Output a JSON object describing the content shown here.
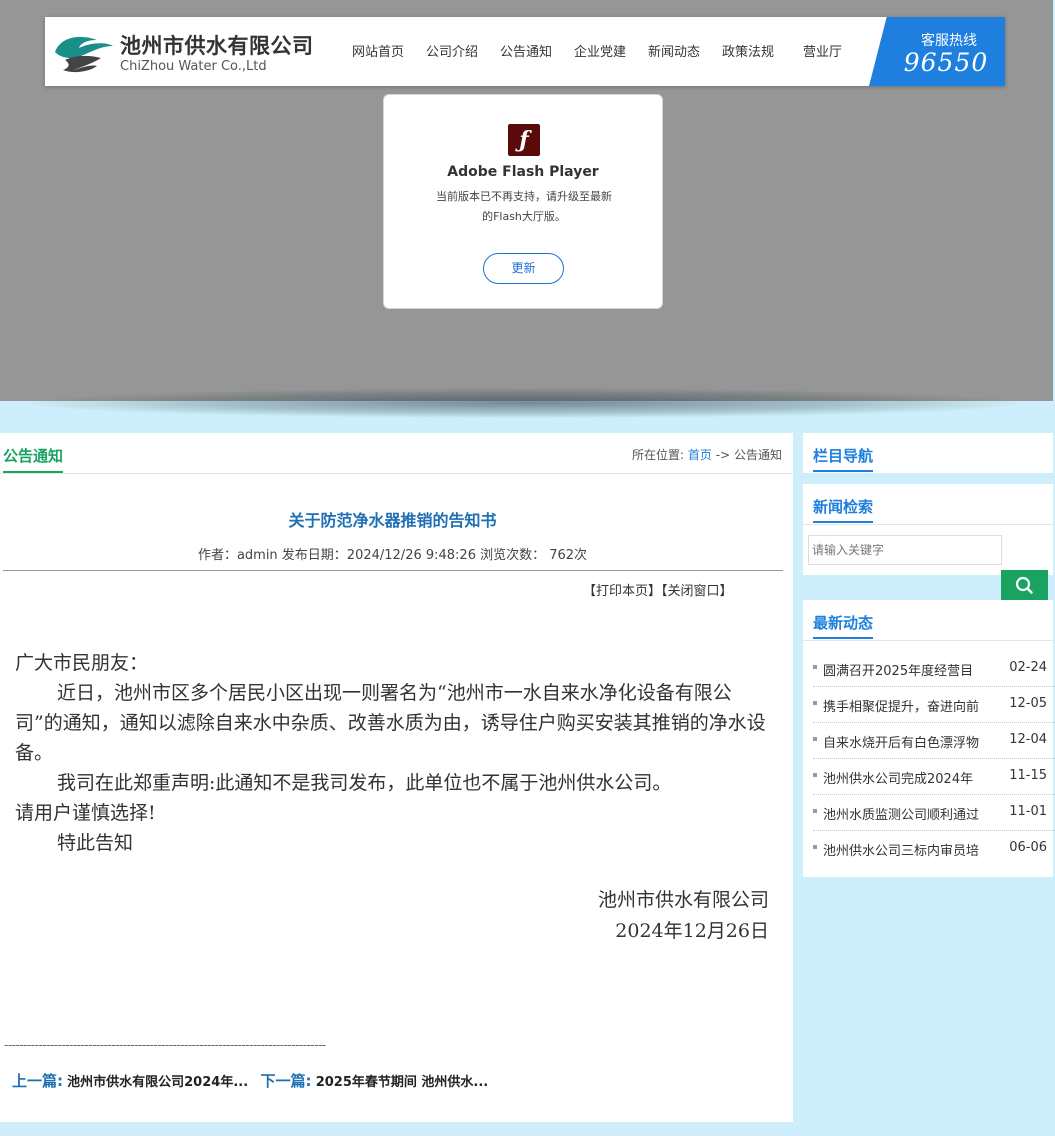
{
  "header": {
    "logo_cn": "池州市供水有限公司",
    "logo_en": "ChiZhou Water Co.,Ltd",
    "nav": [
      "网站首页",
      "公司介绍",
      "公告通知",
      "企业党建",
      "新闻动态",
      "政策法规",
      "营业厅"
    ],
    "hotline_label": "客服热线",
    "hotline_number": "96550"
  },
  "flash": {
    "title": "Adobe Flash Player",
    "desc_line1": "当前版本已不再支持，请升级至最新",
    "desc_line2": "的Flash大厅版。",
    "button": "更新"
  },
  "main": {
    "section_title": "公告通知",
    "breadcrumb_label": "所在位置:",
    "breadcrumb_home": "首页",
    "breadcrumb_sep": "->",
    "breadcrumb_current": "公告通知",
    "article_title": "关于防范净水器推销的告知书",
    "meta": "作者：admin 发布日期：2024/12/26 9:48:26 浏览次数：  762次",
    "print_label": "【打印本页】",
    "close_label": "【关闭窗口】",
    "body": {
      "greeting": "广大市民朋友：",
      "p1": "近日，池州市区多个居民小区出现一则署名为“池州市一水自来水净化设备有限公司”的通知，通知以滤除自来水中杂质、改善水质为由，诱导住户购买安装其推销的净水设备。",
      "p2a": "我司在此郑重声明:此通知不是我司发布，此单位也不属于池州供水公司。",
      "p2b": "请用户谨慎选择!",
      "p3": "特此告知"
    },
    "sign_company": "池州市供水有限公司",
    "sign_date": "2024年12月26日",
    "divider": "------------------------------------------------------------------------------------",
    "prev_label": "上一篇:",
    "prev_title": "池州市供水有限公司2024年...",
    "next_label": "下一篇:",
    "next_title": "2025年春节期间 池州供水..."
  },
  "sidebar": {
    "nav_title": "栏目导航",
    "search_title": "新闻检索",
    "search_placeholder": "请输入关键字",
    "news_title": "最新动态",
    "news": [
      {
        "title": "圆满召开2025年度经营目",
        "date": "02-24"
      },
      {
        "title": "携手相聚促提升，奋进向前",
        "date": "12-05"
      },
      {
        "title": "自来水烧开后有白色漂浮物",
        "date": "12-04"
      },
      {
        "title": "池州供水公司完成2024年",
        "date": "11-15"
      },
      {
        "title": "池州水质监测公司顺利通过",
        "date": "11-01"
      },
      {
        "title": "池州供水公司三标内审员培",
        "date": "06-06"
      }
    ]
  },
  "colors": {
    "accent_green": "#1aa260",
    "accent_blue": "#1e7fde",
    "page_bg": "#cdeefa",
    "banner_bg": "#969696"
  }
}
